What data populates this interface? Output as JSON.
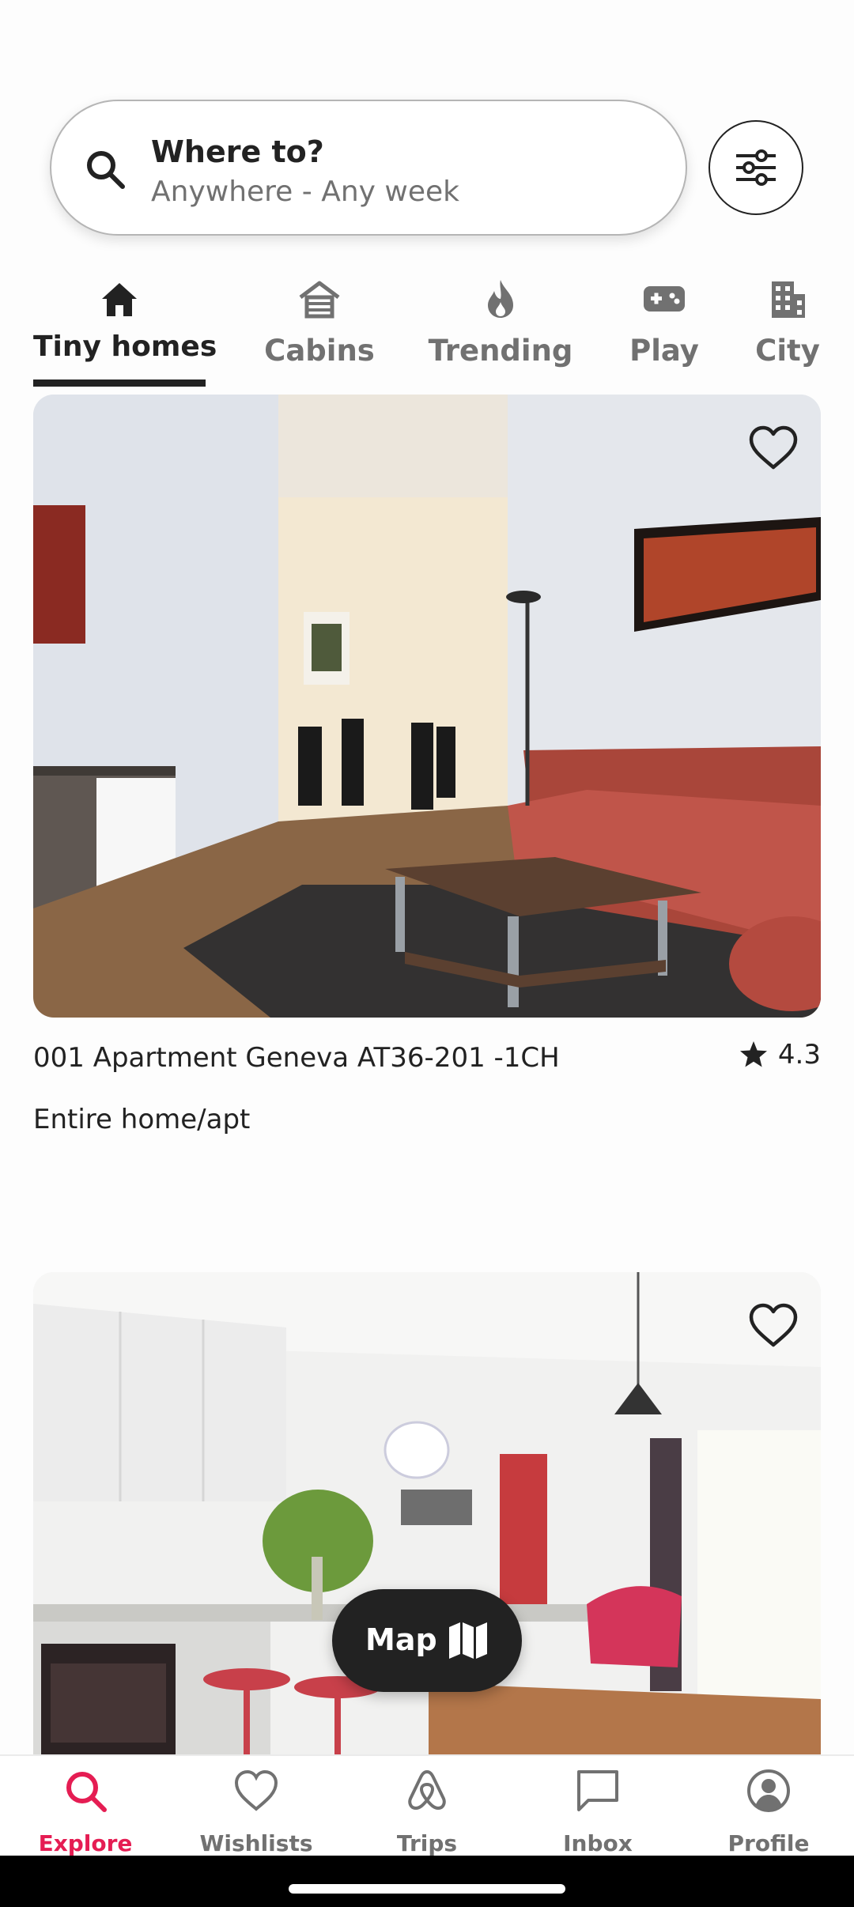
{
  "search": {
    "title": "Where to?",
    "subtitle": "Anywhere - Any week",
    "icon": "search-icon",
    "filter_icon": "sliders-icon"
  },
  "categories": [
    {
      "label": "Tiny homes",
      "icon": "house-icon",
      "active": true
    },
    {
      "label": "Cabins",
      "icon": "cabin-icon",
      "active": false
    },
    {
      "label": "Trending",
      "icon": "flame-icon",
      "active": false
    },
    {
      "label": "Play",
      "icon": "gamepad-icon",
      "active": false
    },
    {
      "label": "City",
      "icon": "building-icon",
      "active": false
    }
  ],
  "listings": [
    {
      "title": "001 Apartment Geneva AT36-201 -1CH",
      "rating": "4.3",
      "type": "Entire home/apt",
      "photo": "living-room-photo"
    },
    {
      "photo": "kitchen-dining-photo"
    }
  ],
  "map_button": {
    "label": "Map",
    "icon": "map-icon"
  },
  "bottom_nav": [
    {
      "label": "Explore",
      "icon": "search-icon",
      "active": true
    },
    {
      "label": "Wishlists",
      "icon": "heart-icon",
      "active": false
    },
    {
      "label": "Trips",
      "icon": "airbnb-logo-icon",
      "active": false
    },
    {
      "label": "Inbox",
      "icon": "message-icon",
      "active": false
    },
    {
      "label": "Profile",
      "icon": "user-circle-icon",
      "active": false
    }
  ],
  "colors": {
    "accent": "#e51d53",
    "text": "#222222",
    "muted": "#717171"
  }
}
